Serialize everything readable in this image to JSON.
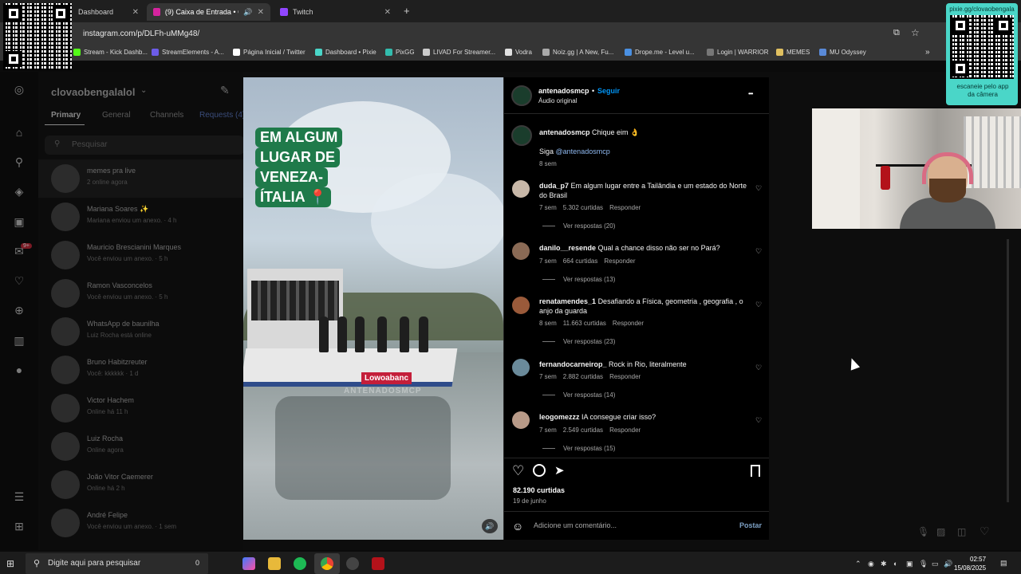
{
  "browser": {
    "tabs": [
      {
        "label": "Dashboard",
        "color": "#4a4a4a"
      },
      {
        "label": "(9) Caixa de Entrada • Conv",
        "color": "#d6249f"
      },
      {
        "label": "Twitch",
        "color": "#9146ff"
      }
    ],
    "new_tab": "+",
    "url": "instagram.com/p/DLFh-uMMg48/",
    "bookmarks": [
      {
        "label": "Stream - Kick Dashb...",
        "color": "#53fc18"
      },
      {
        "label": "StreamElements - A...",
        "color": "#6c5ce7"
      },
      {
        "label": "Página Inicial / Twitter",
        "color": "#ffffff"
      },
      {
        "label": "Dashboard • Pixie",
        "color": "#4ad6c8"
      },
      {
        "label": "PixGG",
        "color": "#32bcad"
      },
      {
        "label": "LIVAD For Streamer...",
        "color": "#cccccc"
      },
      {
        "label": "Vodra",
        "color": "#e0e0e0"
      },
      {
        "label": "Noiz.gg | A New, Fu...",
        "color": "#aaaaaa"
      },
      {
        "label": "Drope.me - Level u...",
        "color": "#4a90e2"
      },
      {
        "label": "Login | WARRIOR",
        "color": "#777777"
      },
      {
        "label": "MEMES",
        "color": "#e0c060"
      },
      {
        "label": "MU Odyssey",
        "color": "#5a8ad8"
      }
    ]
  },
  "dm": {
    "username": "clovaobengalalol",
    "tabs": [
      "Primary",
      "General",
      "Channels",
      "Requests (4)"
    ],
    "search_placeholder": "Pesquisar",
    "conversations": [
      {
        "name": "memes pra live",
        "status": "2 online agora"
      },
      {
        "name": "Mariana Soares ✨",
        "status": "Mariana enviou um anexo. · 4 h"
      },
      {
        "name": "Mauricio Brescianini Marques",
        "status": "Você enviou um anexo. · 5 h"
      },
      {
        "name": "Ramon Vasconcelos",
        "status": "Você enviou um anexo. · 5 h"
      },
      {
        "name": "WhatsApp de baunilha",
        "status": "Luiz Rocha está online"
      },
      {
        "name": "Bruno Habitzreuter",
        "status": "Você: kkkkkk · 1 d"
      },
      {
        "name": "Victor Hachem",
        "status": "Online há 11 h"
      },
      {
        "name": "Luiz Rocha",
        "status": "Online agora"
      },
      {
        "name": "João Vitor Caemerer",
        "status": "Online há 2 h"
      },
      {
        "name": "André Felipe",
        "status": "Você enviou um anexo. · 1 sem"
      }
    ],
    "badge": "9+"
  },
  "video": {
    "caption_lines": [
      "EM ALGUM",
      "LUGAR DE",
      "VENEZA-",
      "ÍTALIA 📍"
    ],
    "boat_logo": "Lowoabanc",
    "watermark": "ANTENADOSMCP"
  },
  "post": {
    "author": "antenadosmcp",
    "follow": "Seguir",
    "separator": "•",
    "audio": "Áudio original",
    "more": "•••",
    "caption_user": "antenadosmcp",
    "caption_text": "Chique eim 👌",
    "caption_mention_prefix": "Siga",
    "caption_mention": "@antenadosmcp",
    "caption_time": "8 sem",
    "comments": [
      {
        "user": "duda_p7",
        "text": "Em algum lugar entre a Tailândia e um estado do Norte do Brasil",
        "time": "7 sem",
        "likes": "5.302 curtidas",
        "reply": "Responder",
        "replies": "Ver respostas (20)",
        "color": "#c8b8a8"
      },
      {
        "user": "danilo__resende",
        "text": "Qual a chance disso não ser no Pará?",
        "time": "7 sem",
        "likes": "664 curtidas",
        "reply": "Responder",
        "replies": "Ver respostas (13)",
        "color": "#8a6a55"
      },
      {
        "user": "renatamendes_1",
        "text": "Desafiando a Física, geometria , geografia , o anjo da guarda",
        "time": "8 sem",
        "likes": "11.663 curtidas",
        "reply": "Responder",
        "replies": "Ver respostas (23)",
        "color": "#9a5a3a"
      },
      {
        "user": "fernandocarneirop_",
        "text": "Rock in Rio, literalmente",
        "time": "7 sem",
        "likes": "2.882 curtidas",
        "reply": "Responder",
        "replies": "Ver respostas (14)",
        "color": "#6a8a9a"
      },
      {
        "user": "leogomezzz",
        "text": "IA consegue criar isso?",
        "time": "7 sem",
        "likes": "2.549 curtidas",
        "reply": "Responder",
        "replies": "Ver respostas (15)",
        "color": "#b89a88"
      }
    ],
    "likes_total": "82.190 curtidas",
    "date": "19 de junho",
    "comment_placeholder": "Adicione um comentário...",
    "post_button": "Postar"
  },
  "qr_right": {
    "label": "pixie.gg/clovaobengala",
    "caption": "escaneie pelo app da câmera"
  },
  "taskbar": {
    "search_placeholder": "Digite aqui para pesquisar",
    "time": "02:57",
    "date": "15/08/2025",
    "zero": "0"
  }
}
